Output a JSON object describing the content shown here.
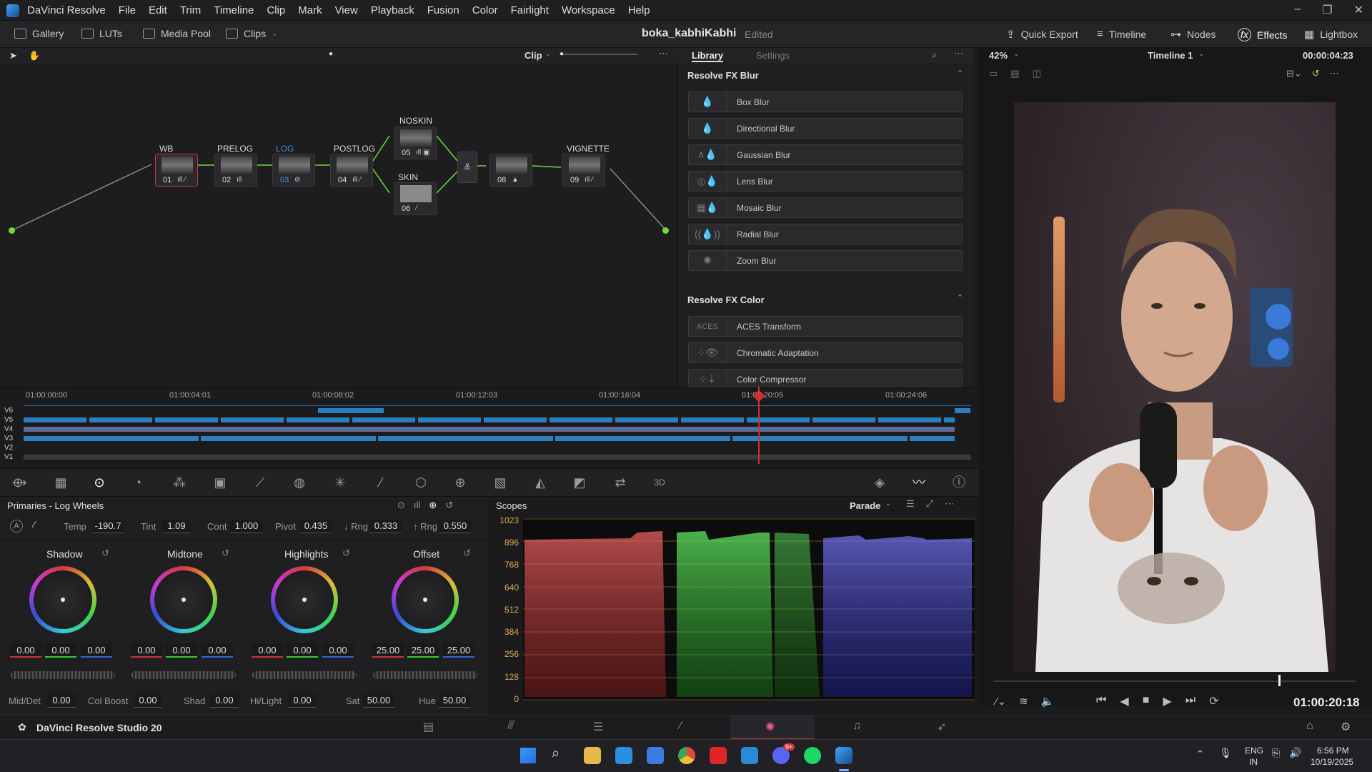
{
  "app": {
    "name": "DaVinci Resolve",
    "menu": [
      "File",
      "Edit",
      "Trim",
      "Timeline",
      "Clip",
      "Mark",
      "View",
      "Playback",
      "Fusion",
      "Color",
      "Fairlight",
      "Workspace",
      "Help"
    ]
  },
  "toolbar": {
    "gallery": "Gallery",
    "luts": "LUTs",
    "media_pool": "Media Pool",
    "clips": "Clips",
    "project_title": "boka_kabhiKabhi",
    "project_status": "Edited",
    "quick_export": "Quick Export",
    "timeline": "Timeline",
    "nodes": "Nodes",
    "effects": "Effects",
    "lightbox": "Lightbox"
  },
  "node_editor": {
    "mode": "Clip",
    "nodes": [
      {
        "num": "01",
        "label": "WB"
      },
      {
        "num": "02",
        "label": "PRELOG"
      },
      {
        "num": "03",
        "label": "LOG"
      },
      {
        "num": "04",
        "label": "POSTLOG"
      },
      {
        "num": "05",
        "label": "NOSKIN"
      },
      {
        "num": "06",
        "label": "SKIN"
      },
      {
        "num": "08",
        "label": ""
      },
      {
        "num": "09",
        "label": "VIGNETTE"
      }
    ]
  },
  "library": {
    "tabs": [
      "Library",
      "Settings"
    ],
    "sections": [
      {
        "title": "Resolve FX Blur",
        "items": [
          "Box Blur",
          "Directional Blur",
          "Gaussian Blur",
          "Lens Blur",
          "Mosaic Blur",
          "Radial Blur",
          "Zoom Blur"
        ]
      },
      {
        "title": "Resolve FX Color",
        "items": [
          "ACES Transform",
          "Chromatic Adaptation",
          "Color Compressor"
        ]
      }
    ]
  },
  "viewer": {
    "zoom": "42%",
    "timeline_name": "Timeline 1",
    "duration": "00:00:04:23",
    "timecode": "01:00:20:18",
    "playhead_fraction": 0.79
  },
  "timeline": {
    "ruler": [
      "01:00:00:00",
      "01:00:04:01",
      "01:00:08:02",
      "01:00:12:03",
      "01:00:16:04",
      "01:00:20:05",
      "01:00:24:06"
    ],
    "tracks": [
      "V6",
      "V5",
      "V4",
      "V3",
      "V2",
      "V1"
    ]
  },
  "primaries": {
    "title": "Primaries - Log Wheels",
    "temp_label": "Temp",
    "temp": "-190.7",
    "tint_label": "Tint",
    "tint": "1.09",
    "cont_label": "Cont",
    "cont": "1.000",
    "pivot_label": "Pivot",
    "pivot": "0.435",
    "lrng_label": "↓ Rng",
    "lrng": "0.333",
    "hrng_label": "↑ Rng",
    "hrng": "0.550",
    "wheels": [
      {
        "name": "Shadow",
        "values": [
          "0.00",
          "0.00",
          "0.00"
        ]
      },
      {
        "name": "Midtone",
        "values": [
          "0.00",
          "0.00",
          "0.00"
        ]
      },
      {
        "name": "Highlights",
        "values": [
          "0.00",
          "0.00",
          "0.00"
        ]
      },
      {
        "name": "Offset",
        "values": [
          "25.00",
          "25.00",
          "25.00"
        ]
      }
    ],
    "middet_label": "Mid/Det",
    "middet": "0.00",
    "colboost_label": "Col Boost",
    "colboost": "0.00",
    "shad_label": "Shad",
    "shad": "0.00",
    "hilight_label": "Hi/Light",
    "hilight": "0.00",
    "sat_label": "Sat",
    "sat": "50.00",
    "hue_label": "Hue",
    "hue": "50.00"
  },
  "scopes": {
    "title": "Scopes",
    "mode": "Parade",
    "scale": [
      "1023",
      "896",
      "768",
      "640",
      "512",
      "384",
      "256",
      "128",
      "0"
    ]
  },
  "footer": {
    "product": "DaVinci Resolve Studio 20"
  },
  "taskbar": {
    "lang": "ENG",
    "region": "IN",
    "time": "6:56 PM",
    "date": "10/19/2025",
    "badge": "9+"
  }
}
